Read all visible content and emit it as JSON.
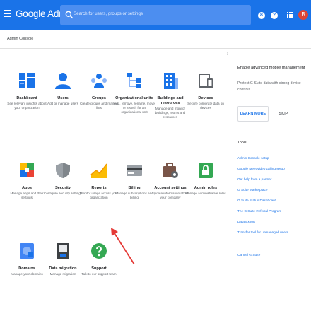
{
  "header": {
    "brand": "Google Admin",
    "search_placeholder": "Search for users, groups or settings",
    "help_glyph": "?",
    "notif_glyph": "8",
    "avatar_letter": "B",
    "bg_color": "#1a73e8"
  },
  "breadcrumb": "Admin Console",
  "tiles": [
    {
      "title": "Dashboard",
      "desc": "See relevant insights about your organization",
      "icon": "dashboard-icon"
    },
    {
      "title": "Users",
      "desc": "Add or manage users",
      "icon": "user-icon"
    },
    {
      "title": "Groups",
      "desc": "Create groups and mailing lists",
      "icon": "groups-icon"
    },
    {
      "title": "Organizational units",
      "desc": "Add, remove, rename, move or search for an organizational unit",
      "icon": "org-units-icon"
    },
    {
      "title": "Buildings and resources",
      "desc": "Manage and monitor buildings, rooms and resources",
      "icon": "building-icon"
    },
    {
      "title": "Devices",
      "desc": "Secure corporate data on devices",
      "icon": "devices-icon"
    },
    {
      "title": "Apps",
      "desc": "Manage apps and their settings",
      "icon": "apps-icon"
    },
    {
      "title": "Security",
      "desc": "Configure security settings",
      "icon": "shield-icon"
    },
    {
      "title": "Reports",
      "desc": "Monitor usage across your organization",
      "icon": "reports-icon"
    },
    {
      "title": "Billing",
      "desc": "Manage subscriptions and billing",
      "icon": "billing-icon"
    },
    {
      "title": "Account settings",
      "desc": "Update information about your company",
      "icon": "account-settings-icon"
    },
    {
      "title": "Admin roles",
      "desc": "Manage administrative roles",
      "icon": "lock-icon"
    },
    {
      "title": "Domains",
      "desc": "Manage your domains",
      "icon": "domains-icon"
    },
    {
      "title": "Data migration",
      "desc": "Manage migration",
      "icon": "data-migration-icon"
    },
    {
      "title": "Support",
      "desc": "Talk to our support team",
      "icon": "support-icon"
    }
  ],
  "panel": {
    "title": "Enable advanced mobile management",
    "desc": "Protect G Suite data with strong device controls",
    "learn_more": "LEARN MORE",
    "skip": "SKIP",
    "tools_title": "Tools",
    "tools": [
      "Admin Console setup",
      "Google Meet video calling setup",
      "Get help from a partner",
      "G Suite Marketplace",
      "G Suite Status Dashboard",
      "The G Suite Referral Program",
      "Data Export",
      "Transfer tool for unmanaged users"
    ],
    "cancel": "Cancel G Suite"
  }
}
